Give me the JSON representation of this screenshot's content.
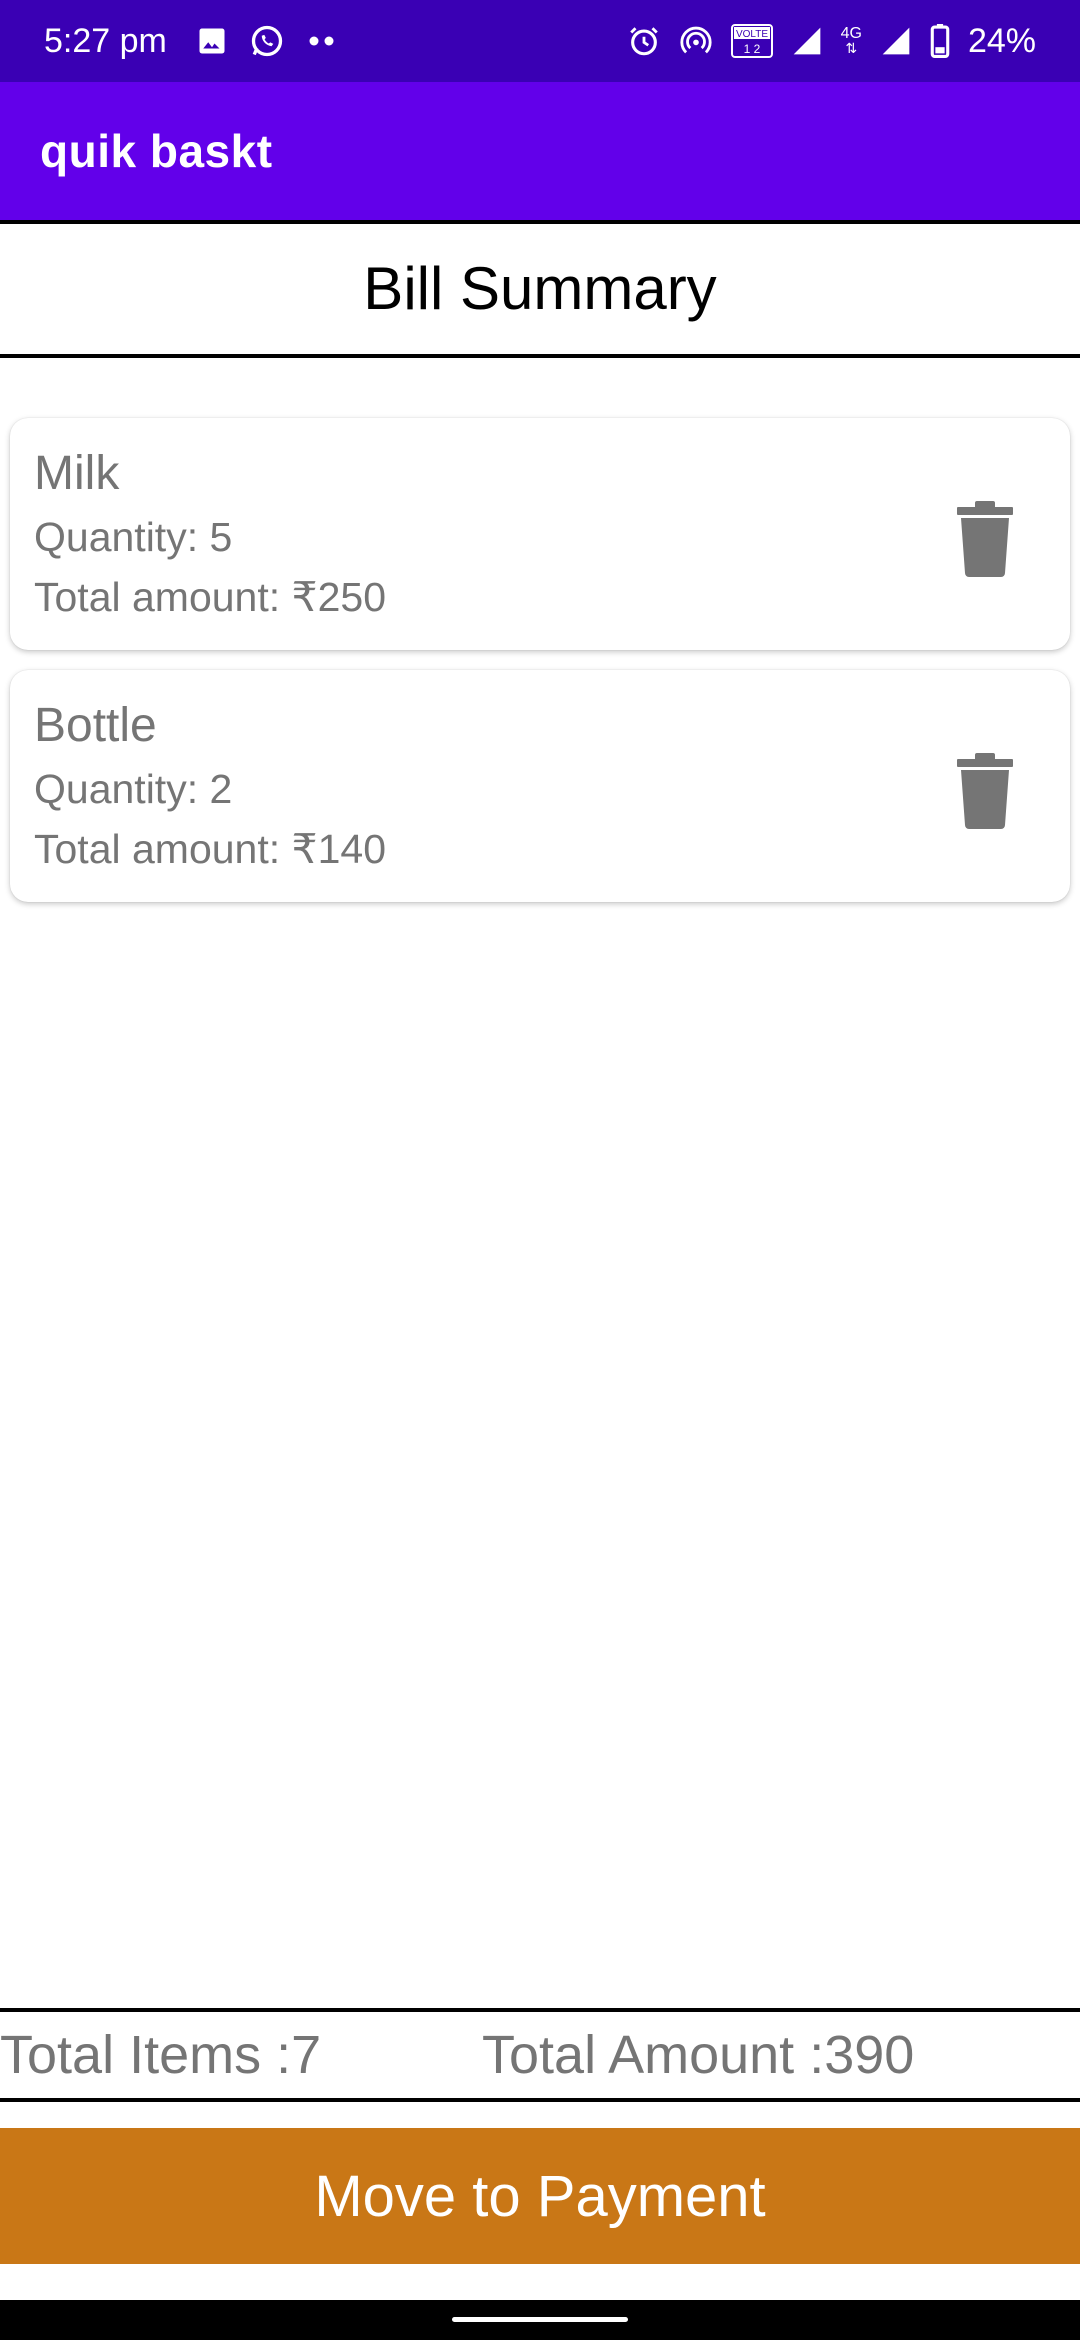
{
  "status_bar": {
    "time": "5:27 pm",
    "battery": "24%",
    "network": "4G",
    "volte": "VOLTE",
    "icons_left": [
      "image-icon",
      "whatsapp-icon",
      "more-dots-icon"
    ],
    "icons_right": [
      "alarm-icon",
      "hotspot-icon",
      "volte-icon",
      "signal-icon",
      "signal-icon",
      "battery-icon"
    ]
  },
  "app_bar": {
    "title": "quik baskt"
  },
  "page": {
    "title": "Bill Summary"
  },
  "items": [
    {
      "name": "Milk",
      "quantity": "Quantity: 5",
      "total": "Total amount: ₹250"
    },
    {
      "name": "Bottle",
      "quantity": "Quantity: 2",
      "total": "Total amount: ₹140"
    }
  ],
  "summary": {
    "total_items": "Total Items :7",
    "total_amount": "Total Amount :390"
  },
  "actions": {
    "payment_label": "Move to Payment"
  },
  "colors": {
    "status_bar": "#3a00b4",
    "app_bar": "#6200ea",
    "payment_button": "#c97716",
    "item_text": "#757575",
    "delete_icon": "#757575"
  }
}
